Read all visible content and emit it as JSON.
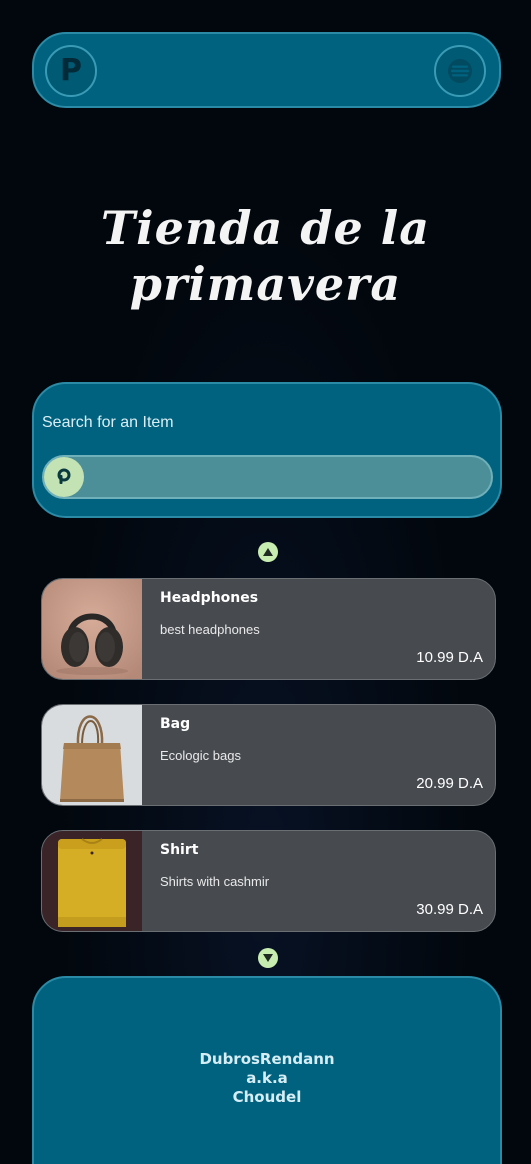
{
  "header": {
    "logo_letter": "P",
    "menu_icon": "hamburger-menu-icon"
  },
  "hero": {
    "title_line1": "Tienda de la",
    "title_line2": "primavera"
  },
  "search": {
    "label": "Search for an Item",
    "value": "",
    "button_icon": "search-icon"
  },
  "scroll": {
    "up_icon": "triangle-up-icon",
    "down_icon": "triangle-down-icon"
  },
  "products": [
    {
      "name": "Headphones",
      "description": "best headphones",
      "price": "10.99 D.A",
      "image": "headphones-image"
    },
    {
      "name": "Bag",
      "description": "Ecologic bags",
      "price": "20.99 D.A",
      "image": "paper-bag-image"
    },
    {
      "name": "Shirt",
      "description": "Shirts with cashmir",
      "price": "30.99 D.A",
      "image": "yellow-shirt-image"
    }
  ],
  "footer": {
    "credit_line1": "DubrosRendann",
    "credit_line2": "a.k.a",
    "credit_line3": "Choudel"
  },
  "colors": {
    "page_bg": "#02070d",
    "panel_bg": "#00627e",
    "panel_border": "#2b8aa6",
    "card_bg": "#474b50",
    "accent_green": "#c8edb0",
    "search_bar_bg": "#4c8f99"
  }
}
